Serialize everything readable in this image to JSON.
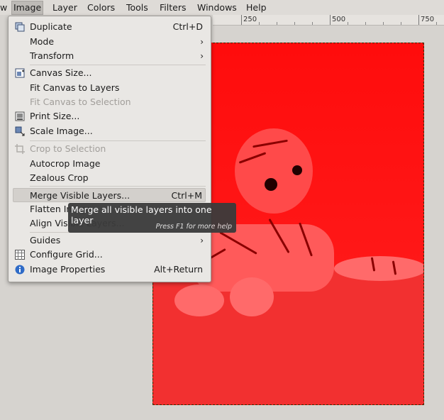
{
  "menubar": {
    "items": [
      "w",
      "Image",
      "Layer",
      "Colors",
      "Tools",
      "Filters",
      "Windows",
      "Help"
    ],
    "active": "Image"
  },
  "ruler": {
    "labels": [
      "250",
      "500",
      "750"
    ]
  },
  "image_menu": {
    "duplicate": {
      "label": "Duplicate",
      "shortcut": "Ctrl+D"
    },
    "mode": {
      "label": "Mode"
    },
    "transform": {
      "label": "Transform"
    },
    "canvas_size": {
      "label": "Canvas Size..."
    },
    "fit_canvas_layers": {
      "label": "Fit Canvas to Layers"
    },
    "fit_canvas_selection": {
      "label": "Fit Canvas to Selection"
    },
    "print_size": {
      "label": "Print Size..."
    },
    "scale_image": {
      "label": "Scale Image..."
    },
    "crop_selection": {
      "label": "Crop to Selection"
    },
    "autocrop": {
      "label": "Autocrop Image"
    },
    "zealous_crop": {
      "label": "Zealous Crop"
    },
    "merge_visible": {
      "label": "Merge Visible Layers...",
      "shortcut": "Ctrl+M"
    },
    "flatten": {
      "label": "Flatten Image"
    },
    "align_visible": {
      "label": "Align Visible Layers..."
    },
    "guides": {
      "label": "Guides"
    },
    "configure_grid": {
      "label": "Configure Grid..."
    },
    "image_properties": {
      "label": "Image Properties",
      "shortcut": "Alt+Return"
    },
    "submenu_arrow": "›"
  },
  "tooltip": {
    "text": "Merge all visible layers into one layer",
    "help": "Press F1 for more help"
  },
  "colors": {
    "canvas": "#ff1a1a",
    "menu_bg": "#e9e7e4",
    "highlight": "#d3d0cc",
    "tooltip_bg": "#3b3b3b"
  }
}
